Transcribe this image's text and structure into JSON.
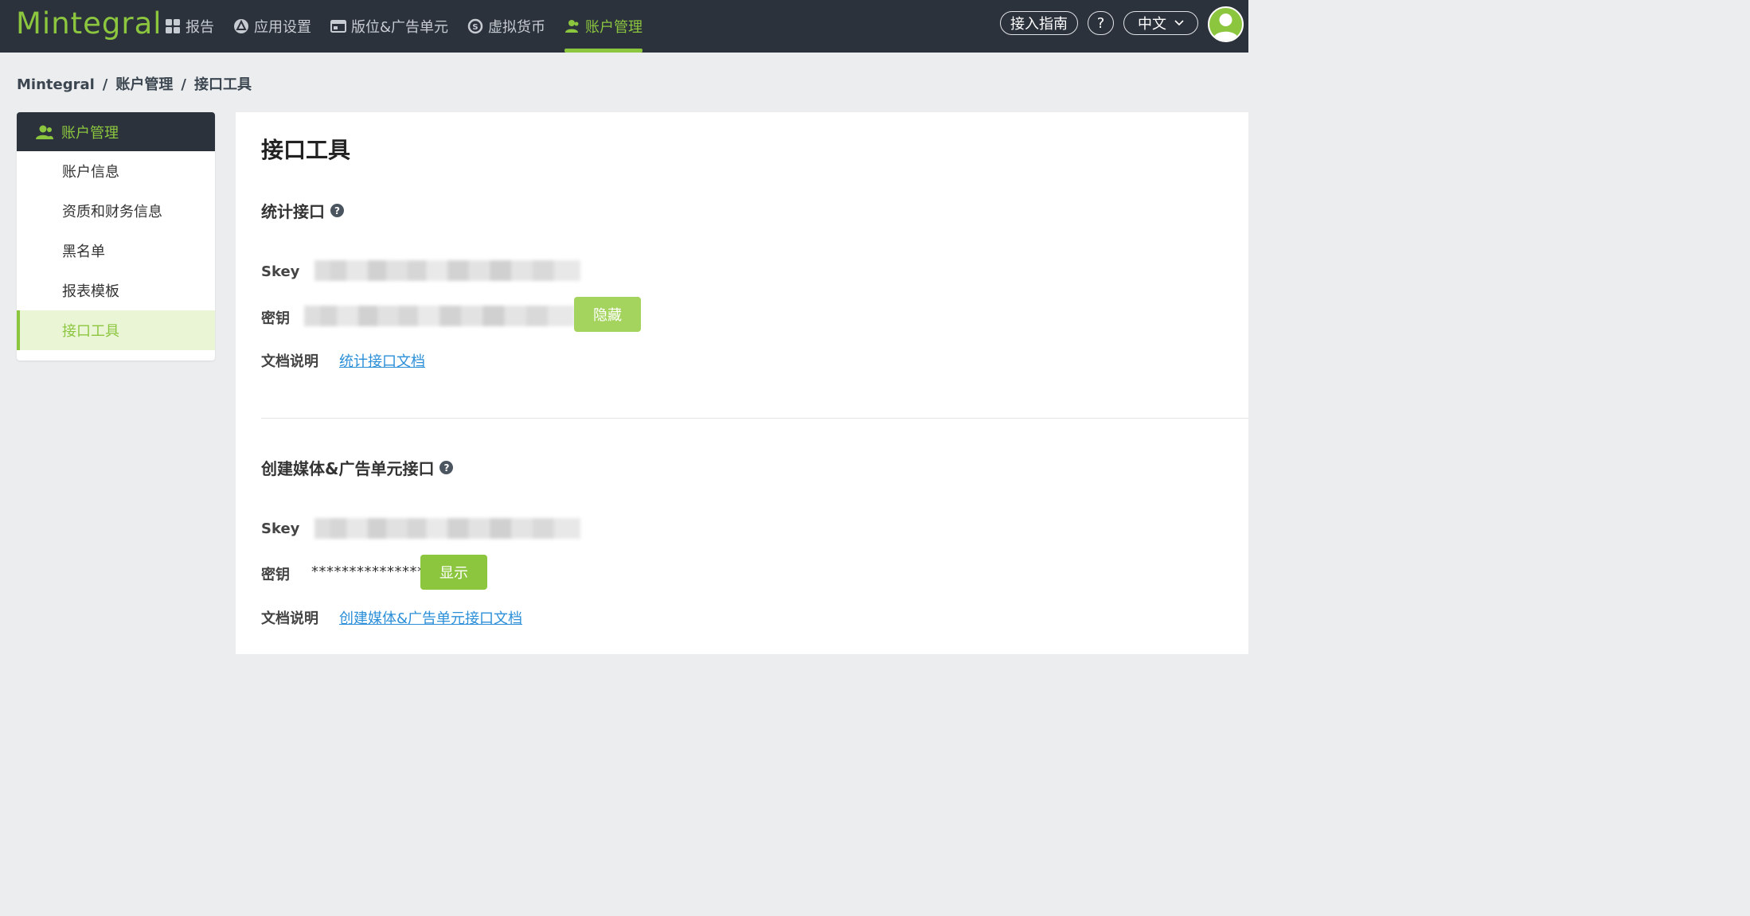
{
  "app": {
    "logo_text": "Mintegral",
    "brand_color": "#8cc63f"
  },
  "nav": {
    "items": [
      {
        "label": "报告",
        "icon": "grid-icon"
      },
      {
        "label": "应用设置",
        "icon": "app-store-icon"
      },
      {
        "label": "版位&广告单元",
        "icon": "ad-unit-icon"
      },
      {
        "label": "虚拟货币",
        "icon": "currency-icon"
      },
      {
        "label": "账户管理",
        "icon": "user-icon",
        "active": true
      }
    ],
    "guide_label": "接入指南",
    "help_label": "?",
    "language_label": "中文"
  },
  "breadcrumb": {
    "items": [
      "Mintegral",
      "账户管理",
      "接口工具"
    ],
    "separator": "/"
  },
  "sidebar": {
    "title": "账户管理",
    "items": [
      {
        "label": "账户信息"
      },
      {
        "label": "资质和财务信息"
      },
      {
        "label": "黑名单"
      },
      {
        "label": "报表模板"
      },
      {
        "label": "接口工具",
        "active": true
      }
    ]
  },
  "main": {
    "title": "接口工具",
    "stats_api": {
      "title": "统计接口",
      "skey_label": "Skey",
      "secret_label": "密钥",
      "hide_button": "隐藏",
      "doc_label": "文档说明",
      "doc_link": "统计接口文档"
    },
    "create_api": {
      "title": "创建媒体&广告单元接口",
      "skey_label": "Skey",
      "secret_label": "密钥",
      "secret_masked": "****************",
      "show_button": "显示",
      "doc_label": "文档说明",
      "doc_link": "创建媒体&广告单元接口文档"
    }
  }
}
